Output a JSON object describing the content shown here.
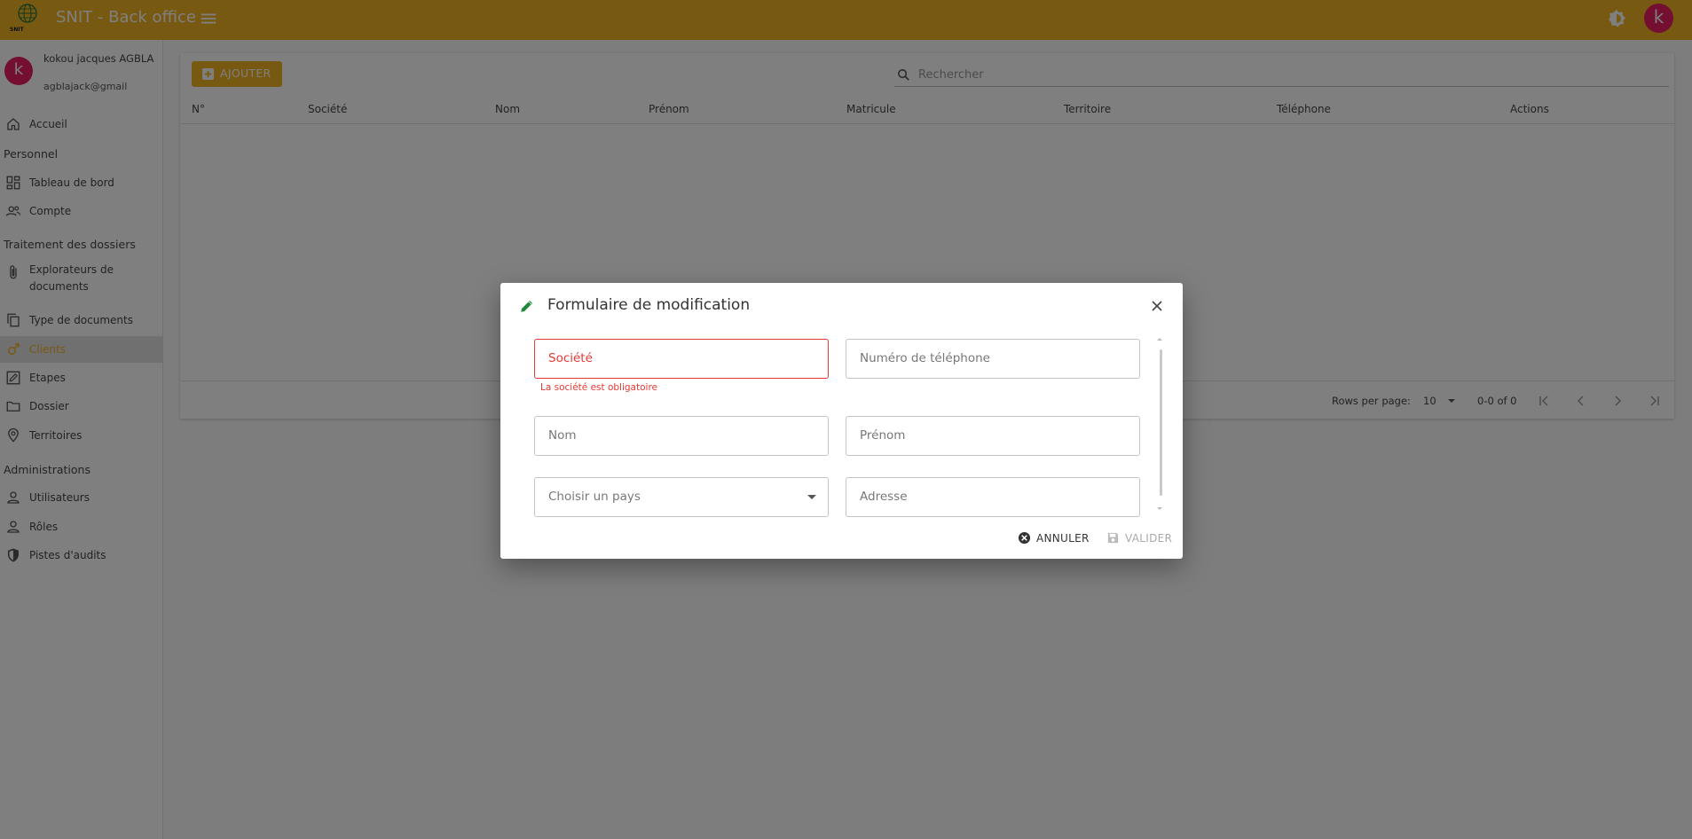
{
  "app": {
    "title": "SNIT - Back office",
    "logo_text": "SNIT",
    "accent": "#f0b323",
    "avatar_letter": "k"
  },
  "user": {
    "name": "kokou jacques AGBLA",
    "email": "agblajack@gmail",
    "avatar_letter": "k"
  },
  "sidebar": {
    "items": [
      {
        "label": "Accueil",
        "icon": "home-icon"
      },
      {
        "section": "Personnel"
      },
      {
        "label": "Tableau de bord",
        "icon": "dashboard-icon"
      },
      {
        "label": "Compte",
        "icon": "account-icon"
      },
      {
        "section": "Traitement des dossiers"
      },
      {
        "label": "Explorateurs de documents",
        "icon": "paperclip-icon"
      },
      {
        "label": "Type de documents",
        "icon": "copy-icon"
      },
      {
        "label": "Clients",
        "icon": "male-icon",
        "active": true
      },
      {
        "label": "Etapes",
        "icon": "edit-box-icon"
      },
      {
        "label": "Dossier",
        "icon": "folder-icon"
      },
      {
        "label": "Territoires",
        "icon": "location-icon"
      },
      {
        "section": "Administrations"
      },
      {
        "label": "Utilisateurs",
        "icon": "user-icon"
      },
      {
        "label": "Rôles",
        "icon": "user-icon"
      },
      {
        "label": "Pistes d'audits",
        "icon": "shield-icon"
      }
    ]
  },
  "main": {
    "add_label": "AJOUTER",
    "search_placeholder": "Rechercher",
    "columns": [
      "N°",
      "Société",
      "Nom",
      "Prénom",
      "Matricule",
      "Territoire",
      "Téléphone",
      "Actions"
    ],
    "rows_per_page_label": "Rows per page:",
    "rows_per_page_value": "10",
    "range_label": "0-0 of 0"
  },
  "dialog": {
    "title": "Formulaire de modification",
    "fields": {
      "societe": "Société",
      "telephone": "Numéro de téléphone",
      "nom": "Nom",
      "prenom": "Prénom",
      "pays": "Choisir un pays",
      "adresse": "Adresse"
    },
    "error_societe": "La société est obligatoire",
    "cancel_label": "ANNULER",
    "validate_label": "VALIDER",
    "error_color": "#e53935"
  }
}
